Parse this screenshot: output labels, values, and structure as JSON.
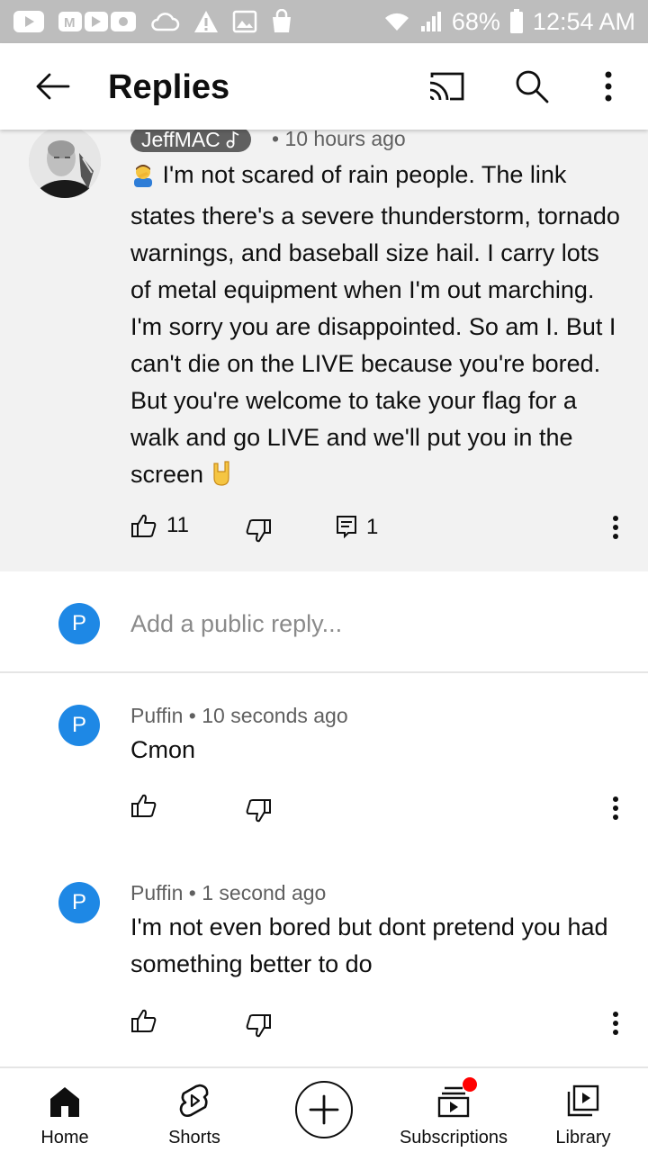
{
  "status_bar": {
    "battery_text": "68%",
    "time": "12:54 AM"
  },
  "app_bar": {
    "title": "Replies",
    "icons": [
      "back-arrow-icon",
      "cast-icon",
      "search-icon",
      "more-vert-icon"
    ]
  },
  "parent_comment": {
    "author": "JeffMAC",
    "time": "• 10 hours ago",
    "text": "I'm not scared of rain people. The link states there's a severe thunderstorm, tornado warnings, and baseball size hail. I carry lots of metal equipment when I'm out marching. I'm sorry you are disappointed. So am I. But I can't die on the LIVE because you're bored. But you're welcome to take your flag for a walk and go LIVE and we'll put you in the screen",
    "likes": "11",
    "replies_count": "1"
  },
  "reply_box": {
    "avatar_letter": "P",
    "placeholder": "Add a public reply..."
  },
  "replies": [
    {
      "avatar_letter": "P",
      "author": "Puffin",
      "time": "• 10 seconds ago",
      "text": "Cmon"
    },
    {
      "avatar_letter": "P",
      "author": "Puffin",
      "time": "• 1 second ago",
      "text": "I'm not even bored but dont pretend you had something better to do"
    }
  ],
  "bottom_nav": {
    "items": [
      {
        "label": "Home",
        "icon": "home-icon"
      },
      {
        "label": "Shorts",
        "icon": "shorts-icon"
      },
      {
        "label": "",
        "icon": "create-icon"
      },
      {
        "label": "Subscriptions",
        "icon": "subscriptions-icon"
      },
      {
        "label": "Library",
        "icon": "library-icon"
      }
    ]
  },
  "colors": {
    "status_bar": "#bdbdbd",
    "parent_bg": "#f2f2f2",
    "avatar_blue": "#1e88e5",
    "notification_dot": "#ff0000"
  }
}
